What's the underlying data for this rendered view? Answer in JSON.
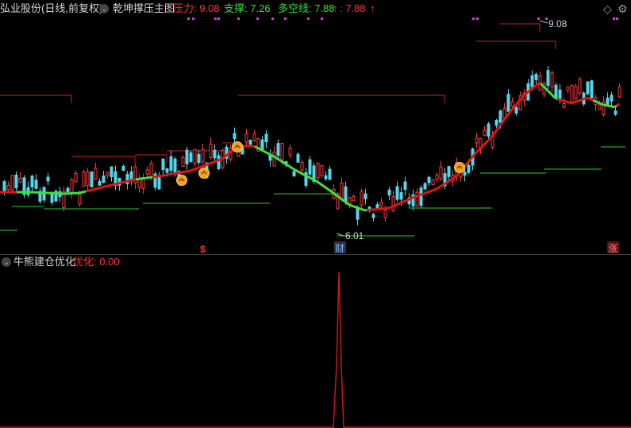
{
  "main_header": {
    "stock_title": "弘业股份(日线,前复权)",
    "indicator_name": "乾坤撑压主图",
    "pressure": "压力: 9.08",
    "support": "支撑: 7.26",
    "longshort": "多空线: 7.88",
    "up_arrow": "↑",
    "extra_value": ": 7.88",
    "extra_arrow": "↑"
  },
  "price_labels": {
    "high": "9.08",
    "low": "6.01"
  },
  "event_markers": {
    "s_marker": "$",
    "cai_marker": "财",
    "zhang_marker": "涨"
  },
  "sub_header": {
    "indicator_name": "牛熊建仓优化",
    "value_label": "优化: 0.00"
  },
  "icons": {
    "collapse": "chevron-down-icon",
    "diamond": "diamond-icon",
    "settings": "gear-icon"
  },
  "colors": {
    "up": "#ff3b3b",
    "down": "#54d6e8",
    "longshort_up": "#e01414",
    "longshort_down": "#3ee03e",
    "support_line": "#2ecc2e",
    "pressure_line": "#d02020",
    "magenta_dot": "#d63ad6",
    "header_red": "#ff3333",
    "header_green": "#33e033"
  }
}
